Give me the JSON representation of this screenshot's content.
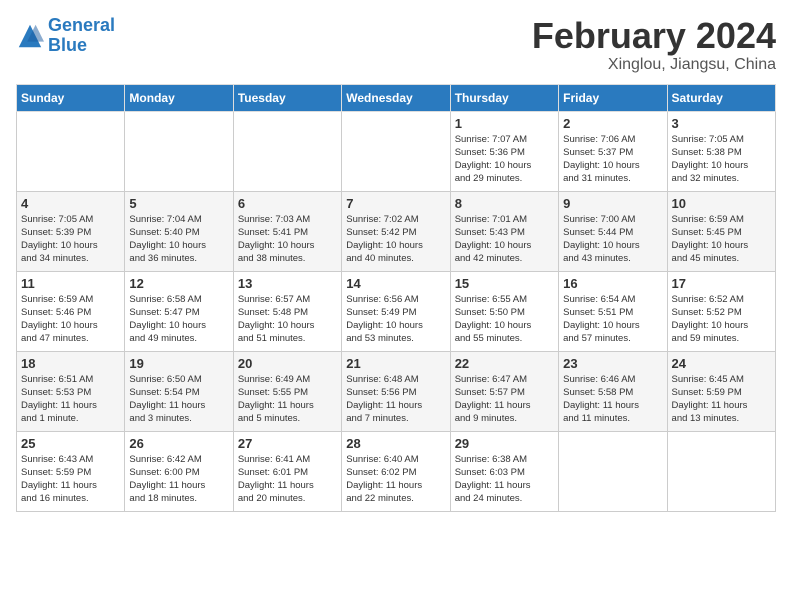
{
  "header": {
    "logo_line1": "General",
    "logo_line2": "Blue",
    "month": "February 2024",
    "location": "Xinglou, Jiangsu, China"
  },
  "weekdays": [
    "Sunday",
    "Monday",
    "Tuesday",
    "Wednesday",
    "Thursday",
    "Friday",
    "Saturday"
  ],
  "weeks": [
    [
      {
        "day": "",
        "info": ""
      },
      {
        "day": "",
        "info": ""
      },
      {
        "day": "",
        "info": ""
      },
      {
        "day": "",
        "info": ""
      },
      {
        "day": "1",
        "info": "Sunrise: 7:07 AM\nSunset: 5:36 PM\nDaylight: 10 hours\nand 29 minutes."
      },
      {
        "day": "2",
        "info": "Sunrise: 7:06 AM\nSunset: 5:37 PM\nDaylight: 10 hours\nand 31 minutes."
      },
      {
        "day": "3",
        "info": "Sunrise: 7:05 AM\nSunset: 5:38 PM\nDaylight: 10 hours\nand 32 minutes."
      }
    ],
    [
      {
        "day": "4",
        "info": "Sunrise: 7:05 AM\nSunset: 5:39 PM\nDaylight: 10 hours\nand 34 minutes."
      },
      {
        "day": "5",
        "info": "Sunrise: 7:04 AM\nSunset: 5:40 PM\nDaylight: 10 hours\nand 36 minutes."
      },
      {
        "day": "6",
        "info": "Sunrise: 7:03 AM\nSunset: 5:41 PM\nDaylight: 10 hours\nand 38 minutes."
      },
      {
        "day": "7",
        "info": "Sunrise: 7:02 AM\nSunset: 5:42 PM\nDaylight: 10 hours\nand 40 minutes."
      },
      {
        "day": "8",
        "info": "Sunrise: 7:01 AM\nSunset: 5:43 PM\nDaylight: 10 hours\nand 42 minutes."
      },
      {
        "day": "9",
        "info": "Sunrise: 7:00 AM\nSunset: 5:44 PM\nDaylight: 10 hours\nand 43 minutes."
      },
      {
        "day": "10",
        "info": "Sunrise: 6:59 AM\nSunset: 5:45 PM\nDaylight: 10 hours\nand 45 minutes."
      }
    ],
    [
      {
        "day": "11",
        "info": "Sunrise: 6:59 AM\nSunset: 5:46 PM\nDaylight: 10 hours\nand 47 minutes."
      },
      {
        "day": "12",
        "info": "Sunrise: 6:58 AM\nSunset: 5:47 PM\nDaylight: 10 hours\nand 49 minutes."
      },
      {
        "day": "13",
        "info": "Sunrise: 6:57 AM\nSunset: 5:48 PM\nDaylight: 10 hours\nand 51 minutes."
      },
      {
        "day": "14",
        "info": "Sunrise: 6:56 AM\nSunset: 5:49 PM\nDaylight: 10 hours\nand 53 minutes."
      },
      {
        "day": "15",
        "info": "Sunrise: 6:55 AM\nSunset: 5:50 PM\nDaylight: 10 hours\nand 55 minutes."
      },
      {
        "day": "16",
        "info": "Sunrise: 6:54 AM\nSunset: 5:51 PM\nDaylight: 10 hours\nand 57 minutes."
      },
      {
        "day": "17",
        "info": "Sunrise: 6:52 AM\nSunset: 5:52 PM\nDaylight: 10 hours\nand 59 minutes."
      }
    ],
    [
      {
        "day": "18",
        "info": "Sunrise: 6:51 AM\nSunset: 5:53 PM\nDaylight: 11 hours\nand 1 minute."
      },
      {
        "day": "19",
        "info": "Sunrise: 6:50 AM\nSunset: 5:54 PM\nDaylight: 11 hours\nand 3 minutes."
      },
      {
        "day": "20",
        "info": "Sunrise: 6:49 AM\nSunset: 5:55 PM\nDaylight: 11 hours\nand 5 minutes."
      },
      {
        "day": "21",
        "info": "Sunrise: 6:48 AM\nSunset: 5:56 PM\nDaylight: 11 hours\nand 7 minutes."
      },
      {
        "day": "22",
        "info": "Sunrise: 6:47 AM\nSunset: 5:57 PM\nDaylight: 11 hours\nand 9 minutes."
      },
      {
        "day": "23",
        "info": "Sunrise: 6:46 AM\nSunset: 5:58 PM\nDaylight: 11 hours\nand 11 minutes."
      },
      {
        "day": "24",
        "info": "Sunrise: 6:45 AM\nSunset: 5:59 PM\nDaylight: 11 hours\nand 13 minutes."
      }
    ],
    [
      {
        "day": "25",
        "info": "Sunrise: 6:43 AM\nSunset: 5:59 PM\nDaylight: 11 hours\nand 16 minutes."
      },
      {
        "day": "26",
        "info": "Sunrise: 6:42 AM\nSunset: 6:00 PM\nDaylight: 11 hours\nand 18 minutes."
      },
      {
        "day": "27",
        "info": "Sunrise: 6:41 AM\nSunset: 6:01 PM\nDaylight: 11 hours\nand 20 minutes."
      },
      {
        "day": "28",
        "info": "Sunrise: 6:40 AM\nSunset: 6:02 PM\nDaylight: 11 hours\nand 22 minutes."
      },
      {
        "day": "29",
        "info": "Sunrise: 6:38 AM\nSunset: 6:03 PM\nDaylight: 11 hours\nand 24 minutes."
      },
      {
        "day": "",
        "info": ""
      },
      {
        "day": "",
        "info": ""
      }
    ]
  ]
}
